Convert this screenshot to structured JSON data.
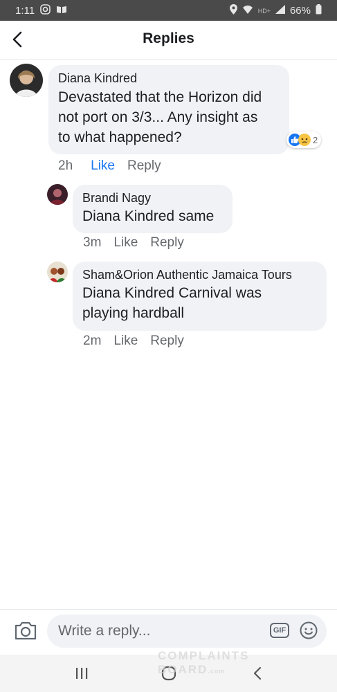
{
  "status_bar": {
    "time": "1:11",
    "battery": "66%",
    "network": "HD+"
  },
  "header": {
    "title": "Replies"
  },
  "comments": [
    {
      "author": "Diana Kindred",
      "mention": "",
      "text_lines": [
        "Devastated that the Horizon did",
        "not port on 3/3... Any insight as",
        "to what happened?"
      ],
      "time": "2h",
      "like_label": "Like",
      "reply_label": "Reply",
      "reaction_count": "2",
      "reactions": [
        "like-icon",
        "sad-icon"
      ]
    },
    {
      "author": "Brandi Nagy",
      "mention": "Diana Kindred",
      "text": "same",
      "time": "3m",
      "like_label": "Like",
      "reply_label": "Reply"
    },
    {
      "author": "Sham&Orion Authentic Jamaica Tours",
      "mention": "Diana Kindred",
      "text_lines": [
        "Carnival was",
        "playing hardball"
      ],
      "time": "2m",
      "like_label": "Like",
      "reply_label": "Reply"
    }
  ],
  "composer": {
    "placeholder": "Write a reply...",
    "gif_label": "GIF"
  },
  "watermark": {
    "line1": "COMPLAINTS",
    "line2": "BOARD",
    "suffix": ".com"
  },
  "colors": {
    "accent": "#1877f2",
    "bubble": "#f0f2f5",
    "meta": "#65676b"
  }
}
